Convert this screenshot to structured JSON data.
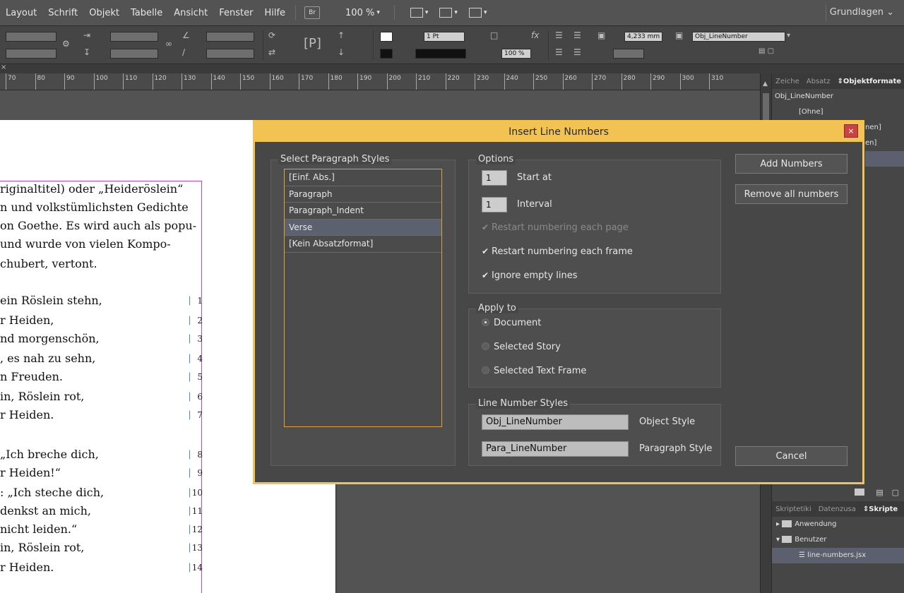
{
  "menubar": {
    "items": [
      "Layout",
      "Schrift",
      "Objekt",
      "Tabelle",
      "Ansicht",
      "Fenster",
      "Hilfe"
    ],
    "bridge_label": "Br",
    "zoom": "100 %",
    "workspace": "Grundlagen"
  },
  "controlbar": {
    "stroke_weight": "1 Pt",
    "dimension": "4,233 mm",
    "object_style": "Obj_LineNumber",
    "scale": "100 %"
  },
  "ruler": {
    "ticks": [
      "70",
      "80",
      "90",
      "100",
      "110",
      "120",
      "130",
      "140",
      "150",
      "160",
      "170",
      "180",
      "190",
      "200",
      "210",
      "220",
      "230",
      "240",
      "250",
      "260",
      "270",
      "280",
      "290",
      "300",
      "310"
    ]
  },
  "document": {
    "lines": [
      "riginaltitel) oder „Heideröslein“",
      "n und volkstümlichsten Gedichte",
      "on Goethe. Es wird auch als popu-",
      "und wurde von vielen Kompo-",
      "chubert, vertont.",
      "ein Röslein stehn,",
      "r Heiden,",
      "nd morgenschön,",
      ", es nah zu sehn,",
      "n Freuden.",
      "in, Röslein rot,",
      "r Heiden.",
      "„Ich breche dich,",
      "r Heiden!“",
      ": „Ich steche dich,",
      "denkst an mich,",
      "nicht leiden.“",
      "in, Röslein rot,",
      "r Heiden."
    ],
    "line_numbers": [
      "1",
      "2",
      "3",
      "4",
      "5",
      "6",
      "7",
      "8",
      "9",
      "10",
      "11",
      "12",
      "13",
      "14"
    ]
  },
  "styles_panel": {
    "tabs": [
      "Zeiche",
      "Absatz",
      "Objektformate"
    ],
    "items": [
      "Obj_LineNumber",
      "[Ohne]",
      "nen]",
      "en]"
    ]
  },
  "scripts_panel": {
    "tabs": [
      "Skriptetiki",
      "Datenzusa",
      "Skripte"
    ],
    "items": [
      "Anwendung",
      "Benutzer",
      "line-numbers.jsx"
    ]
  },
  "dialog": {
    "title": "Insert Line Numbers",
    "select_styles_label": "Select Paragraph Styles",
    "paragraph_styles": [
      "[Einf. Abs.]",
      "Paragraph",
      "Paragraph_Indent",
      "Verse",
      "[Kein Absatzformat]"
    ],
    "selected_style": "Verse",
    "options_label": "Options",
    "start_at_value": "1",
    "start_at_label": "Start at",
    "interval_value": "1",
    "interval_label": "Interval",
    "restart_page_label": "Restart numbering each page",
    "restart_frame_label": "Restart numbering each frame",
    "ignore_empty_label": "Ignore empty lines",
    "apply_to_label": "Apply to",
    "apply_document": "Document",
    "apply_story": "Selected Story",
    "apply_frame": "Selected Text Frame",
    "line_number_styles_label": "Line Number Styles",
    "object_style_value": "Obj_LineNumber",
    "object_style_label": "Object Style",
    "paragraph_style_value": "Para_LineNumber",
    "paragraph_style_label": "Paragraph Style",
    "add_button": "Add Numbers",
    "remove_button": "Remove all numbers",
    "cancel_button": "Cancel",
    "close_label": "×"
  }
}
